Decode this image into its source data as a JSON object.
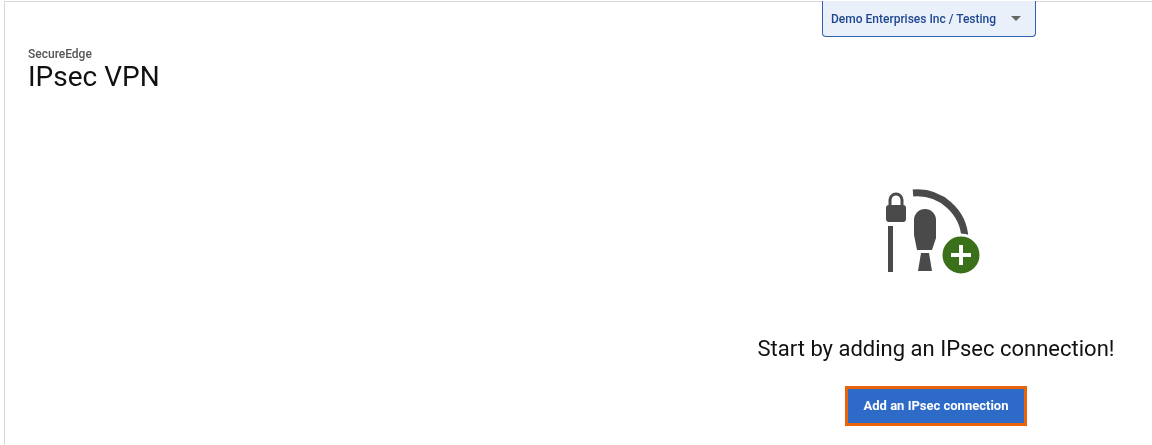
{
  "account_selector": {
    "value": "Demo Enterprises Inc / Testing"
  },
  "header": {
    "breadcrumb": "SecureEdge",
    "title": "IPsec VPN"
  },
  "empty_state": {
    "message": "Start by adding an IPsec connection!",
    "button": {
      "label": "Add an IPsec connection",
      "focused": true
    }
  }
}
